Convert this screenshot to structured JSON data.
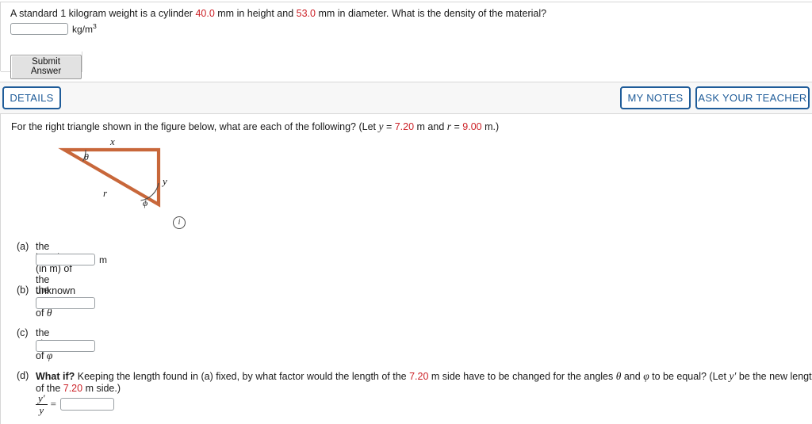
{
  "question_density": {
    "text_before_1": "A standard 1 kilogram weight is a cylinder ",
    "value_height": "40.0",
    "text_mid": " mm in height and ",
    "value_diameter": "53.0",
    "text_after": " mm in diameter. What is the density of the material?",
    "answer_value": "",
    "unit_base": "kg/m",
    "unit_exponent": "3",
    "submit_label": "Submit Answer"
  },
  "toolbar": {
    "details_label": "DETAILS",
    "my_notes_label": "MY NOTES",
    "ask_teacher_label": "ASK YOUR TEACHER",
    "accent_color": "#1f5c99",
    "bar_background": "#f7f7f7"
  },
  "question_triangle": {
    "prompt_before": "For the right triangle shown in the figure below, what are each of the following? (Let ",
    "prompt_var_y": "y",
    "prompt_eq1": " = ",
    "prompt_val_y": "7.20",
    "prompt_mid": " m and ",
    "prompt_var_r": "r",
    "prompt_eq2": " = ",
    "prompt_val_r": "9.00",
    "prompt_after": " m.)",
    "figure": {
      "side_color": "#c8673a",
      "label_x": "x",
      "label_y": "y",
      "label_r": "r",
      "label_theta": "θ",
      "label_phi": "ϕ",
      "info_icon_glyph": "i"
    },
    "parts": [
      {
        "label": "(a)",
        "text_before": "the length (in m) of the unknown side ",
        "text_var": "x",
        "answer_value": "",
        "unit": "m"
      },
      {
        "label": "(b)",
        "text_before": "the tangent of ",
        "text_var": "θ",
        "answer_value": "",
        "unit": ""
      },
      {
        "label": "(c)",
        "text_before": "the sine of ",
        "text_var": "φ",
        "answer_value": "",
        "unit": ""
      }
    ],
    "part_d": {
      "label": "(d)",
      "bold_lead": "What if?",
      "text_1": " Keeping the length found in (a) fixed, by what factor would the length of the ",
      "value_1": "7.20",
      "text_2": " m side have to be changed for the angles ",
      "var_theta": "θ",
      "text_3": " and ",
      "var_phi": "φ",
      "text_4": " to be equal? (Let ",
      "var_yprime": "y′",
      "text_5": " be the new length of the ",
      "value_2": "7.20",
      "text_6": " m side.)",
      "fraction_numerator": "y′",
      "fraction_denominator": "y",
      "equals": "=",
      "answer_value": ""
    }
  }
}
